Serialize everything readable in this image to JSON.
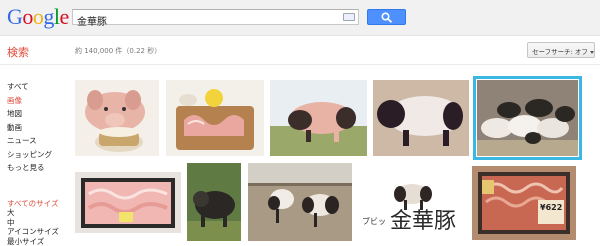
{
  "logo": {
    "letters": [
      "G",
      "o",
      "o",
      "g",
      "l",
      "e"
    ],
    "colors": [
      "#3369e8",
      "#d50f25",
      "#eeb211",
      "#3369e8",
      "#009925",
      "#d50f25"
    ]
  },
  "search": {
    "query": "金華豚",
    "button_icon": "magnifier-icon",
    "keyboard_icon": "keyboard-icon"
  },
  "results": {
    "section_title": "検索",
    "stats": "約 140,000 件（0.22 秒）"
  },
  "safesearch": {
    "label": "セーフサーチ: オフ"
  },
  "nav": {
    "items": [
      "すべて",
      "画像",
      "地図",
      "動画",
      "ニュース",
      "ショッピング",
      "もっと見る"
    ],
    "active_index": 1
  },
  "size_filter": {
    "heading": "すべてのサイズ",
    "items": [
      "大",
      "中",
      "アイコンサイズ",
      "最小サイズ"
    ]
  },
  "images": {
    "row1": [
      "pig-with-bowl-photo",
      "pork-dish-photo",
      "pig-on-grass-photo",
      "pig-side-view-photo",
      "pigs-in-pen-photo"
    ],
    "row2": [
      "packaged-pork-photo",
      "black-pig-photo",
      "pigs-in-yard-photo",
      "pig-with-caption-photo",
      "pork-package-photo"
    ],
    "caption_main": "金華豚",
    "caption_small": "ブビッ",
    "price_label": "¥622"
  },
  "colors": {
    "accent_red": "#dd4b39",
    "search_blue": "#4d90fe",
    "selection": "#3ab7e2"
  }
}
